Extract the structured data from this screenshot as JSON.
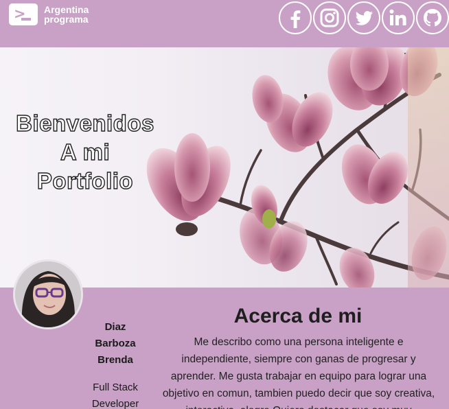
{
  "header": {
    "logo": {
      "line1": "Argentina",
      "line2": "programa",
      "icon": "terminal-icon"
    },
    "socials": [
      {
        "name": "facebook",
        "icon": "facebook-icon"
      },
      {
        "name": "instagram",
        "icon": "instagram-icon"
      },
      {
        "name": "twitter",
        "icon": "twitter-icon"
      },
      {
        "name": "linkedin",
        "icon": "linkedin-icon"
      },
      {
        "name": "github",
        "icon": "github-icon"
      }
    ]
  },
  "hero": {
    "line1": "Bienvenidos",
    "line2": "A mi",
    "line3": "Portfolio"
  },
  "profile": {
    "name_line1": "Diaz",
    "name_line2": "Barboza",
    "name_line3": "Brenda",
    "role_line1": "Full Stack",
    "role_line2": "Developer"
  },
  "about": {
    "title": "Acerca de mi",
    "text": "Me describo como una persona inteligente e independiente, siempre con ganas de progresar y aprender. Me gusta trabajar en equipo para lograr una objetivo en comun, tambien puedo decir que soy creativa, interactiva, alegre Quiero destacar que soy muy"
  },
  "colors": {
    "background": "#c9a0c6",
    "white": "#ffffff"
  }
}
